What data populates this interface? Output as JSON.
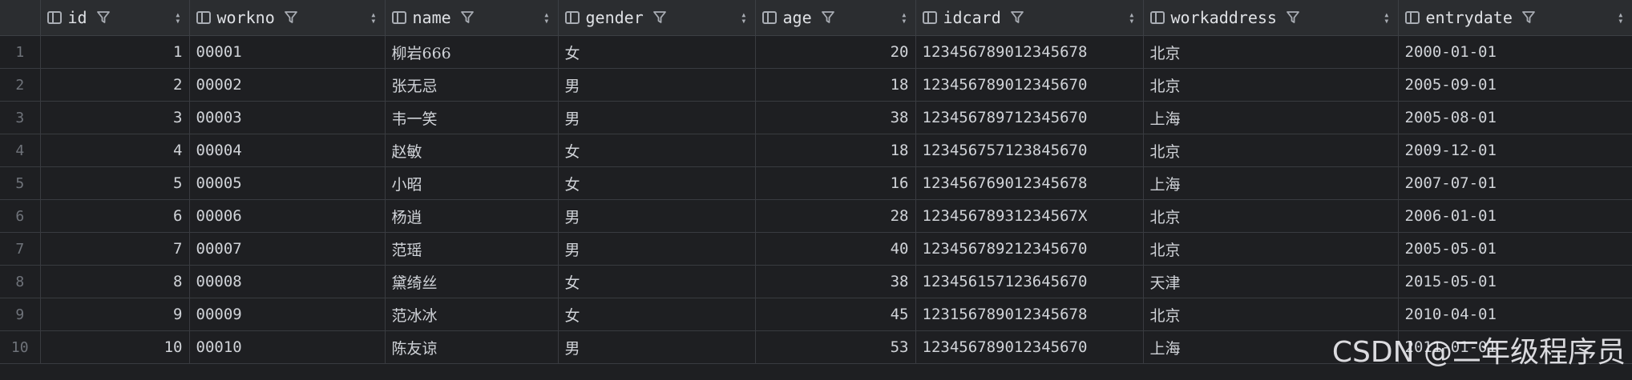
{
  "columns": [
    {
      "key": "id",
      "label": "id"
    },
    {
      "key": "workno",
      "label": "workno"
    },
    {
      "key": "name",
      "label": "name"
    },
    {
      "key": "gender",
      "label": "gender"
    },
    {
      "key": "age",
      "label": "age"
    },
    {
      "key": "idcard",
      "label": "idcard"
    },
    {
      "key": "workaddress",
      "label": "workaddress"
    },
    {
      "key": "entrydate",
      "label": "entrydate"
    }
  ],
  "rows": [
    {
      "row": "1",
      "id": "1",
      "workno": "00001",
      "name": "柳岩666",
      "gender": "女",
      "age": "20",
      "idcard": "123456789012345678",
      "workaddress": "北京",
      "entrydate": "2000-01-01"
    },
    {
      "row": "2",
      "id": "2",
      "workno": "00002",
      "name": "张无忌",
      "gender": "男",
      "age": "18",
      "idcard": "123456789012345670",
      "workaddress": "北京",
      "entrydate": "2005-09-01"
    },
    {
      "row": "3",
      "id": "3",
      "workno": "00003",
      "name": "韦一笑",
      "gender": "男",
      "age": "38",
      "idcard": "123456789712345670",
      "workaddress": "上海",
      "entrydate": "2005-08-01"
    },
    {
      "row": "4",
      "id": "4",
      "workno": "00004",
      "name": "赵敏",
      "gender": "女",
      "age": "18",
      "idcard": "123456757123845670",
      "workaddress": "北京",
      "entrydate": "2009-12-01"
    },
    {
      "row": "5",
      "id": "5",
      "workno": "00005",
      "name": "小昭",
      "gender": "女",
      "age": "16",
      "idcard": "123456769012345678",
      "workaddress": "上海",
      "entrydate": "2007-07-01"
    },
    {
      "row": "6",
      "id": "6",
      "workno": "00006",
      "name": "杨逍",
      "gender": "男",
      "age": "28",
      "idcard": "12345678931234567X",
      "workaddress": "北京",
      "entrydate": "2006-01-01"
    },
    {
      "row": "7",
      "id": "7",
      "workno": "00007",
      "name": "范瑶",
      "gender": "男",
      "age": "40",
      "idcard": "123456789212345670",
      "workaddress": "北京",
      "entrydate": "2005-05-01"
    },
    {
      "row": "8",
      "id": "8",
      "workno": "00008",
      "name": "黛绮丝",
      "gender": "女",
      "age": "38",
      "idcard": "123456157123645670",
      "workaddress": "天津",
      "entrydate": "2015-05-01"
    },
    {
      "row": "9",
      "id": "9",
      "workno": "00009",
      "name": "范冰冰",
      "gender": "女",
      "age": "45",
      "idcard": "123156789012345678",
      "workaddress": "北京",
      "entrydate": "2010-04-01"
    },
    {
      "row": "10",
      "id": "10",
      "workno": "00010",
      "name": "陈友谅",
      "gender": "男",
      "age": "53",
      "idcard": "123456789012345670",
      "workaddress": "上海",
      "entrydate": "2011-01-01"
    }
  ],
  "watermark": "CSDN @二年级程序员",
  "icons": {
    "column": "column-icon",
    "filter": "filter-icon",
    "sort": "sort-icon"
  },
  "colors": {
    "background": "#1e1f22",
    "header": "#2b2d30",
    "grid": "#393b40"
  }
}
